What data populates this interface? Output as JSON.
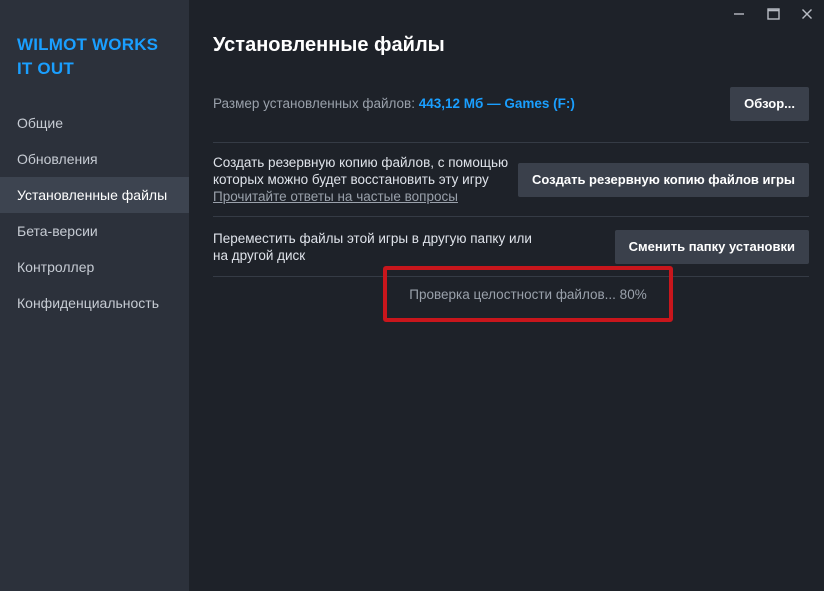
{
  "window": {
    "minimize_glyph": "—",
    "maximize_glyph": "☐",
    "close_glyph": "✕"
  },
  "sidebar": {
    "game_title": "WILMOT WORKS IT OUT",
    "items": [
      {
        "label": "Общие"
      },
      {
        "label": "Обновления"
      },
      {
        "label": "Установленные файлы"
      },
      {
        "label": "Бета-версии"
      },
      {
        "label": "Контроллер"
      },
      {
        "label": "Конфиденциальность"
      }
    ],
    "active_index": 2
  },
  "main": {
    "title": "Установленные файлы",
    "size_label": "Размер установленных файлов:",
    "size_value": "443,12 Мб — Games (F:)",
    "browse_button": "Обзор...",
    "backup_text": "Создать резервную копию файлов, с помощью которых можно будет восстановить эту игру",
    "faq_link": "Прочитайте ответы на частые вопросы",
    "backup_button": "Создать резервную копию файлов игры",
    "move_text": "Переместить файлы этой игры в другую папку или на другой диск",
    "move_button": "Сменить папку установки",
    "verify_status": "Проверка целостности файлов... 80%"
  },
  "colors": {
    "accent": "#1a9fff",
    "highlight_border": "#c8161c",
    "sidebar_bg": "#2c313b",
    "main_bg": "#1e2229"
  }
}
